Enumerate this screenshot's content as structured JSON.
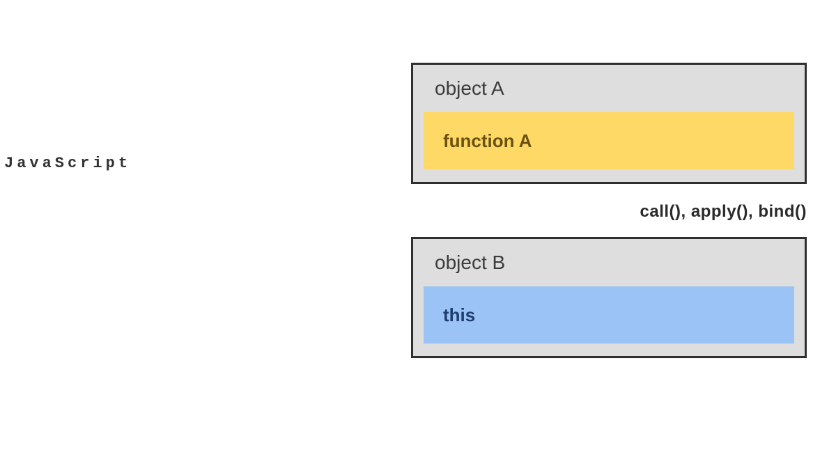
{
  "sideLabel": "JavaScript",
  "objectA": {
    "title": "object A",
    "innerLabel": "function A"
  },
  "methodsLabel": "call(), apply(), bind()",
  "objectB": {
    "title": "object B",
    "innerLabel": "this"
  }
}
